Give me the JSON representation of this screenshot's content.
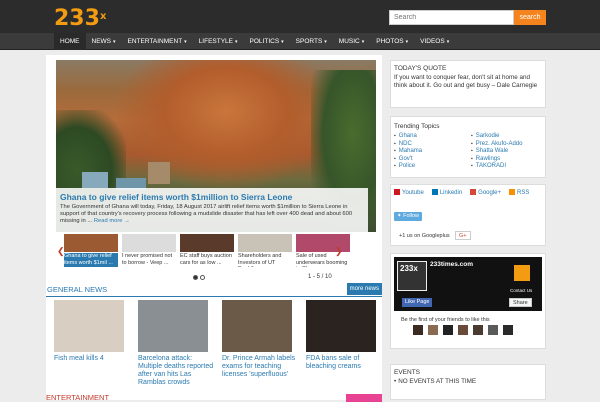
{
  "header": {
    "logo": "233",
    "logo_sup": "x",
    "search_placeholder": "Search",
    "search_button": "search"
  },
  "nav": [
    {
      "label": "HOME",
      "caret": false,
      "active": true
    },
    {
      "label": "NEWS",
      "caret": true
    },
    {
      "label": "ENTERTAINMENT",
      "caret": true
    },
    {
      "label": "LIFESTYLE",
      "caret": true
    },
    {
      "label": "POLITICS",
      "caret": true
    },
    {
      "label": "SPORTS",
      "caret": true
    },
    {
      "label": "MUSIC",
      "caret": true
    },
    {
      "label": "PHOTOS",
      "caret": true
    },
    {
      "label": "VIDEOS",
      "caret": true
    }
  ],
  "slider": {
    "title": "Ghana to give relief items worth $1million to Sierra Leone",
    "text": "The Government of Ghana will today, Friday, 18 August 2017 airlift relief items worth $1million to Sierra Leone in support of that country's recovery process following a mudslide disaster that has left over 400 dead and about 600 missing in ...",
    "more": "Read more →",
    "counter": "1 - 5 / 10",
    "thumbs": [
      {
        "caption": "Ghana to give relief items worth $1mil ...",
        "color": "#9c5a32",
        "active": true
      },
      {
        "caption": "I never promised not to borrow - Veep ...",
        "color": "#dcdcdc"
      },
      {
        "caption": "EC staff buys auction cars for as low ...",
        "color": "#5a3a2a"
      },
      {
        "caption": "Shareholders and Investors of UT Bank& ...",
        "color": "#c9c2b6"
      },
      {
        "caption": "Sale of used underwears booming in Gha ...",
        "color": "#b14a6a"
      }
    ]
  },
  "general_news": {
    "title": "GENERAL NEWS",
    "more": "more news",
    "items": [
      {
        "caption": "Fish meal kills 4",
        "color": "#d8cfc2"
      },
      {
        "caption": "Barcelona attack: Multiple deaths reported after van hits Las Ramblas crowds",
        "color": "#8a8f94"
      },
      {
        "caption": "Dr. Prince Armah labels exams for teaching licenses 'superfluous'",
        "color": "#6b5a48"
      },
      {
        "caption": "FDA bans sale of bleaching creams",
        "color": "#2a2320"
      }
    ]
  },
  "entertainment": {
    "title": "ENTERTAINMENT"
  },
  "quote": {
    "title": "TODAY'S QUOTE",
    "text": "If you want to conquer fear, don't sit at home and think about it. Go out and get busy – Dale Carnegie"
  },
  "trending": {
    "title": "Trending Topics",
    "left": [
      "Ghana",
      "NDC",
      "Mahama",
      "Gov't",
      "Police"
    ],
    "right": [
      "Sarkodie",
      "Prez. Akufo-Addo",
      "Shatta Wale",
      "Rawlings",
      "TAKORADI"
    ]
  },
  "social": {
    "youtube": "Youtube",
    "linkedin": "Linkedin",
    "googleplus": "Google+",
    "rss": "RSS",
    "follow": "Follow",
    "gplus_text": "+1 us on Googleplus",
    "gplus_btn": "G+"
  },
  "facebook": {
    "logo": "233x",
    "name": "233times.com",
    "contact": "Contact Us",
    "like": "Like Page",
    "share": "Share",
    "friends": "Be the first of your friends to like this"
  },
  "events": {
    "title": "EVENTS",
    "item": "NO EVENTS AT THIS TIME"
  },
  "colors": {
    "accent_blue": "#2a7ab0",
    "orange": "#f5841f",
    "nav_bg": "#3b3b3b"
  }
}
